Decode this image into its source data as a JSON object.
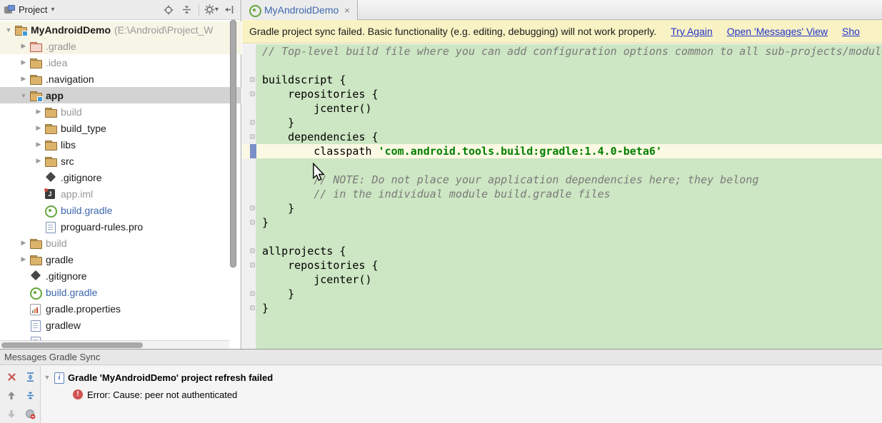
{
  "colors": {
    "editor-bg": "#cde6c3",
    "hl-bg": "#fbf9e3",
    "banner-bg": "#f8f2c4",
    "sel-bg": "#d3d3d3",
    "link": "#2433cc",
    "file-blue": "#3d67ad",
    "string-green": "#008000",
    "error-red": "#d25252",
    "tool-blue": "#3e7cc4"
  },
  "glyphs": {
    "caret_down": "▾",
    "arrow_down": "▼",
    "arrow_right": "▶",
    "close": "×",
    "exclamation": "!"
  },
  "project_panel": {
    "header": {
      "title": "Project",
      "tools": [
        "locate",
        "collapse-all",
        "settings-gear",
        "hide-panel"
      ]
    },
    "tree": [
      {
        "indent": 0,
        "arrow": "down",
        "icon": "folder-project",
        "label": "MyAndroidDemo",
        "bold": true,
        "sublabel": "(E:\\Android\\Project_W",
        "bg": "cream"
      },
      {
        "indent": 1,
        "arrow": "right",
        "icon": "folder-red",
        "label": ".gradle",
        "color": "gray",
        "bg": "cream"
      },
      {
        "indent": 1,
        "arrow": "right",
        "icon": "folder",
        "label": ".idea",
        "color": "gray"
      },
      {
        "indent": 1,
        "arrow": "right",
        "icon": "folder",
        "label": ".navigation"
      },
      {
        "indent": 1,
        "arrow": "down",
        "icon": "folder-project",
        "label": "app",
        "bold": true,
        "selected": true
      },
      {
        "indent": 2,
        "arrow": "right",
        "icon": "folder",
        "label": "build",
        "color": "gray"
      },
      {
        "indent": 2,
        "arrow": "right",
        "icon": "folder",
        "label": "build_type"
      },
      {
        "indent": 2,
        "arrow": "right",
        "icon": "folder",
        "label": "libs"
      },
      {
        "indent": 2,
        "arrow": "right",
        "icon": "folder",
        "label": "src"
      },
      {
        "indent": 2,
        "icon": "gitignore",
        "label": ".gitignore"
      },
      {
        "indent": 2,
        "icon": "iml",
        "label": "app.iml",
        "color": "gray"
      },
      {
        "indent": 2,
        "icon": "gradle",
        "label": "build.gradle",
        "color": "blue"
      },
      {
        "indent": 2,
        "icon": "doc",
        "label": "proguard-rules.pro"
      },
      {
        "indent": 1,
        "arrow": "right",
        "icon": "folder",
        "label": "build",
        "color": "gray"
      },
      {
        "indent": 1,
        "arrow": "right",
        "icon": "folder",
        "label": "gradle"
      },
      {
        "indent": 1,
        "icon": "gitignore",
        "label": ".gitignore"
      },
      {
        "indent": 1,
        "icon": "gradle",
        "label": "build.gradle",
        "color": "blue"
      },
      {
        "indent": 1,
        "icon": "props",
        "label": "gradle.properties"
      },
      {
        "indent": 1,
        "icon": "doc",
        "label": "gradlew"
      },
      {
        "indent": 1,
        "icon": "doc",
        "label": ""
      }
    ]
  },
  "editor": {
    "tab": {
      "label": "MyAndroidDemo",
      "icon": "gradle"
    },
    "banner": {
      "message": "Gradle project sync failed. Basic functionality (e.g. editing, debugging) will not work properly.",
      "links": [
        "Try Again",
        "Open 'Messages' View",
        "Sho"
      ]
    },
    "code_lines": [
      {
        "style": "comment",
        "text": "// Top-level build file where you can add configuration options common to all sub-projects/modules."
      },
      {
        "text": ""
      },
      {
        "text": "buildscript {",
        "fold": true
      },
      {
        "text": "    repositories {",
        "fold": true
      },
      {
        "text": "        jcenter()"
      },
      {
        "text": "    }",
        "fold": true
      },
      {
        "text": "    dependencies {",
        "fold": true
      },
      {
        "highlight": true,
        "mark": true,
        "segments": [
          {
            "t": "        classpath ",
            "s": "code"
          },
          {
            "t": "'com.android.tools.build:gradle:1.4.0-beta6'",
            "s": "string"
          }
        ]
      },
      {
        "text": ""
      },
      {
        "style": "comment",
        "text": "        // NOTE: Do not place your application dependencies here; they belong"
      },
      {
        "style": "comment",
        "text": "        // in the individual module build.gradle files"
      },
      {
        "text": "    }",
        "fold": true
      },
      {
        "text": "}",
        "fold": true
      },
      {
        "text": ""
      },
      {
        "text": "allprojects {",
        "fold": true
      },
      {
        "text": "    repositories {",
        "fold": true
      },
      {
        "text": "        jcenter()"
      },
      {
        "text": "    }",
        "fold": true
      },
      {
        "text": "}",
        "fold": true
      }
    ]
  },
  "messages_panel": {
    "title": "Messages Gradle Sync",
    "toolbar": [
      "close",
      "up",
      "down",
      "expand-all",
      "collapse-all",
      "help"
    ],
    "node_title": "Gradle 'MyAndroidDemo' project refresh failed",
    "error_text": "Error: Cause: peer not authenticated"
  }
}
